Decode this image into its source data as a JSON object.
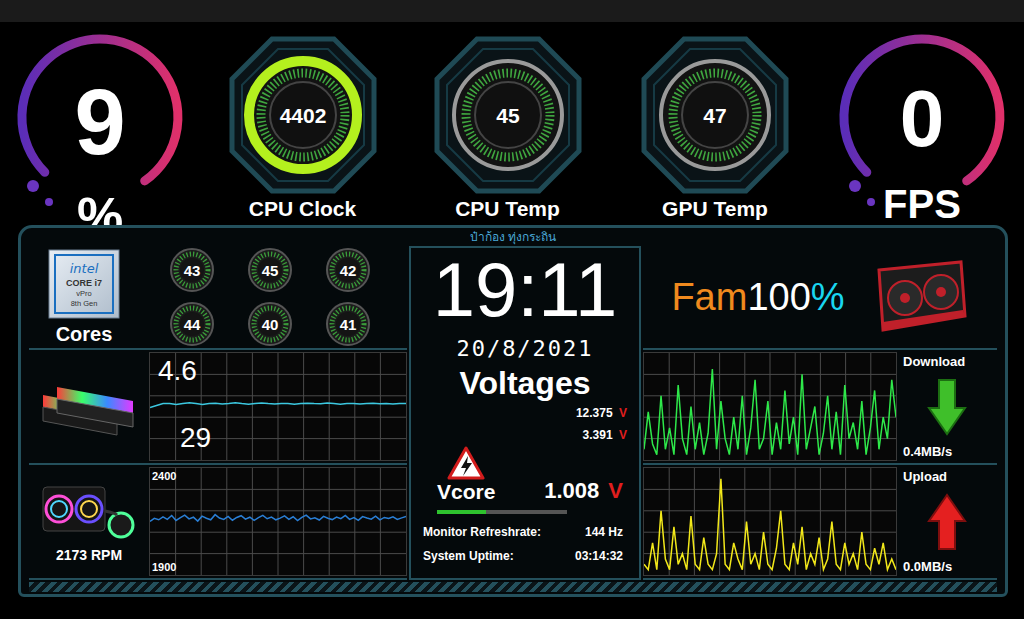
{
  "load": {
    "value": "9",
    "unit": "%"
  },
  "gauges": [
    {
      "value": "4402",
      "label": "CPU Clock",
      "color": "#b4f01e"
    },
    {
      "value": "45",
      "label": "CPU Temp",
      "color": "#9a9a9a"
    },
    {
      "value": "47",
      "label": "GPU Temp",
      "color": "#9a9a9a"
    }
  ],
  "fps": {
    "value": "0",
    "unit": "FPS"
  },
  "banner": "ป๋าก้อง ทุ่งกระถิน",
  "cpu": {
    "logo": {
      "brand": "intel",
      "line": "CORE i7",
      "sub": "vPro",
      "gen": "8th Gen"
    },
    "label": "Cores",
    "cores": [
      "43",
      "45",
      "42",
      "44",
      "40",
      "41"
    ]
  },
  "memory": {
    "top": "4.6",
    "bottom": "29",
    "values": [
      27,
      28,
      29,
      29,
      28.5,
      29,
      29.5,
      29,
      28.5,
      29,
      29.2,
      28.8,
      29,
      29.4,
      29,
      28.7,
      29,
      29.3,
      29,
      28.8,
      29.1,
      29,
      28.6,
      29,
      29.2,
      29,
      28.9,
      29.3,
      29,
      28.7,
      29,
      29.1,
      28.8,
      29,
      29.2,
      28.9,
      29,
      28.8,
      29.1,
      29
    ]
  },
  "fan": {
    "reading": "2173 RPM",
    "axis_max": "2400",
    "axis_min": "1900",
    "values": [
      2150,
      2165,
      2158,
      2172,
      2160,
      2178,
      2155,
      2168,
      2180,
      2162,
      2170,
      2152,
      2175,
      2165,
      2158,
      2182,
      2166,
      2160,
      2174,
      2156,
      2169,
      2177,
      2161,
      2170,
      2155,
      2168,
      2179,
      2163,
      2171,
      2158,
      2166,
      2176,
      2160,
      2172,
      2154,
      2169,
      2180,
      2162,
      2167,
      2157,
      2174,
      2165,
      2159,
      2171,
      2163,
      2178,
      2160,
      2168,
      2155,
      2173,
      2166,
      2161,
      2175,
      2158,
      2169,
      2164,
      2172,
      2160,
      2167,
      2173
    ]
  },
  "clock": {
    "time": "19:11",
    "date": "20/8/2021"
  },
  "voltages": {
    "title": "Voltages",
    "rails": [
      {
        "value": "12.375",
        "unit": "V"
      },
      {
        "value": "3.391",
        "unit": "V"
      }
    ],
    "vcore": {
      "label": "Vcore",
      "value": "1.008",
      "unit": "V",
      "level": 0.38
    }
  },
  "info": [
    {
      "label": "Monitor Refreshrate:",
      "value": "144 Hz"
    },
    {
      "label": "System Uptime:",
      "value": "03:14:32"
    }
  ],
  "gpu_fan": {
    "parts": [
      {
        "text": "Fam",
        "color": "#f08a1e"
      },
      {
        "text": "100",
        "color": "#ffffff"
      },
      {
        "text": "%",
        "color": "#19d6f0"
      }
    ]
  },
  "network": [
    {
      "label": "Download",
      "rate": "0.4MB/s",
      "color": "#2ee84a",
      "direction": "down",
      "values": [
        0.1,
        0.45,
        0.15,
        0.05,
        0.6,
        0.1,
        0.3,
        0.05,
        0.7,
        0.2,
        0.05,
        0.5,
        0.1,
        0.35,
        0.05,
        0.25,
        0.85,
        0.1,
        0.55,
        0.2,
        0.05,
        0.4,
        0.1,
        0.6,
        0.05,
        0.3,
        0.75,
        0.1,
        0.2,
        0.55,
        0.05,
        0.35,
        0.1,
        0.65,
        0.15,
        0.4,
        0.05,
        0.8,
        0.1,
        0.3,
        0.5,
        0.05,
        0.25,
        0.6,
        0.1,
        0.45,
        0.05,
        0.7,
        0.2,
        0.35,
        0.1,
        0.55,
        0.05,
        0.3,
        0.65,
        0.1,
        0.4,
        0.2,
        0.75,
        0.4
      ]
    },
    {
      "label": "Upload",
      "rate": "0.0MB/s",
      "color": "#f2e81a",
      "direction": "up",
      "values": [
        0.1,
        0.05,
        0.3,
        0.05,
        0.6,
        0.15,
        0.05,
        0.45,
        0.1,
        0.2,
        0.05,
        0.55,
        0.1,
        0.05,
        0.35,
        0.1,
        0.05,
        0.2,
        0.9,
        0.1,
        0.05,
        0.3,
        0.15,
        0.05,
        0.5,
        0.1,
        0.2,
        0.05,
        0.4,
        0.1,
        0.05,
        0.25,
        0.6,
        0.1,
        0.05,
        0.3,
        0.1,
        0.45,
        0.05,
        0.2,
        0.1,
        0.35,
        0.05,
        0.15,
        0.5,
        0.1,
        0.05,
        0.3,
        0.1,
        0.2,
        0.05,
        0.4,
        0.1,
        0.05,
        0.25,
        0.1,
        0.3,
        0.05,
        0.15,
        0.05
      ]
    }
  ]
}
